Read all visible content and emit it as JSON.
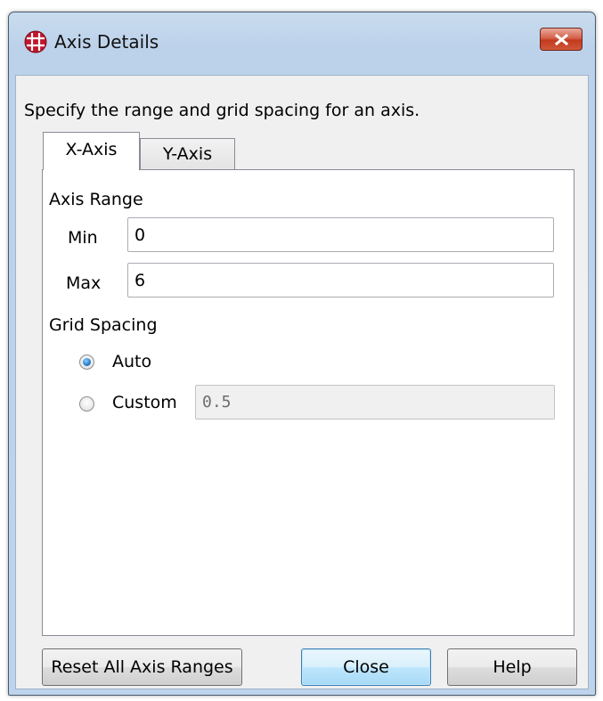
{
  "window": {
    "title": "Axis Details",
    "close_label": "✕"
  },
  "description": "Specify the range and grid spacing for an axis.",
  "tabs": [
    {
      "label": "X-Axis",
      "selected": true
    },
    {
      "label": "Y-Axis",
      "selected": false
    }
  ],
  "axis_range": {
    "heading": "Axis Range",
    "min_label": "Min",
    "min_value": "0",
    "max_label": "Max",
    "max_value": "6"
  },
  "grid_spacing": {
    "heading": "Grid Spacing",
    "auto_label": "Auto",
    "auto_selected": true,
    "custom_label": "Custom",
    "custom_selected": false,
    "custom_value": "0.5"
  },
  "buttons": {
    "reset_label": "Reset All Axis Ranges",
    "close_label": "Close",
    "help_label": "Help"
  },
  "icons": {
    "app": "grid-globe-icon",
    "close": "close-icon"
  },
  "colors": {
    "app_icon": "#c0162c",
    "close_button": "#c8452a",
    "radio_selected": "#2a7fd0"
  }
}
